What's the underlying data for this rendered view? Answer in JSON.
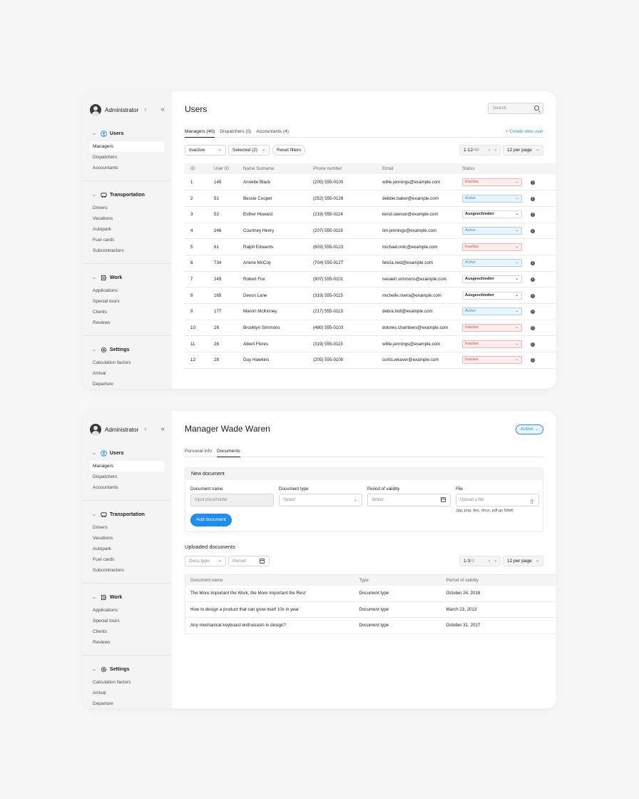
{
  "sidebar": {
    "admin_name": "Administrator",
    "sections": [
      {
        "title": "Users",
        "items": [
          "Managers",
          "Dispatchers",
          "Accountants"
        ]
      },
      {
        "title": "Transportation",
        "items": [
          "Drivers",
          "Vacations",
          "Autopark",
          "Fuel cards",
          "Subcontractors"
        ]
      },
      {
        "title": "Work",
        "items": [
          "Applications",
          "Special tours",
          "Clients",
          "Reviews"
        ]
      },
      {
        "title": "Settings",
        "items": [
          "Calculation factors",
          "Arrival",
          "Departure"
        ]
      }
    ]
  },
  "users_page": {
    "title": "Users",
    "search_placeholder": "Search",
    "tabs": [
      "Managers (40)",
      "Dispatchers (0)",
      "Accountants (4)"
    ],
    "create_link": "+ Create new user",
    "filter_status": "Inactive",
    "filter_selected": "Selected (2)",
    "reset_filters": "Reset filters",
    "pagination": {
      "range": "1-12",
      "total": "/40"
    },
    "per_page": "12 per page",
    "columns": [
      "ID",
      "User ID",
      "Name Surname",
      "Phone number",
      "Email",
      "Status"
    ],
    "rows": [
      {
        "id": "1",
        "uid": "145",
        "name": "Annette Black",
        "phone": "(205) 555-0100",
        "email": "willie.jennings@example.com",
        "status": "Inactive",
        "kind": "inactive",
        "info": true
      },
      {
        "id": "2",
        "uid": "51",
        "name": "Bessie Cooper",
        "phone": "(252) 555-0126",
        "email": "debbie.baker@example.com",
        "status": "Active",
        "kind": "active",
        "info": true
      },
      {
        "id": "3",
        "uid": "52",
        "name": "Esther Howard",
        "phone": "(219) 555-0114",
        "email": "kenzi.lawson@example.com",
        "status": "Ausgeschieden",
        "kind": "aus",
        "info": true
      },
      {
        "id": "4",
        "uid": "246",
        "name": "Courtney Henry",
        "phone": "(207) 555-0119",
        "email": "tim.jennings@example.com",
        "status": "Active",
        "kind": "active",
        "info": true
      },
      {
        "id": "5",
        "uid": "61",
        "name": "Ralph Edwards",
        "phone": "(603) 555-0123",
        "email": "michael.mitc@example.com",
        "status": "Inactive",
        "kind": "inactive",
        "info": false
      },
      {
        "id": "6",
        "uid": "734",
        "name": "Arlene McCoy",
        "phone": "(704) 555-0127",
        "email": "felicia.reid@example.com",
        "status": "Active",
        "kind": "active",
        "info": true
      },
      {
        "id": "7",
        "uid": "245",
        "name": "Robert Fox",
        "phone": "(907) 555-0101",
        "email": "nevaeh.simmons@example.com",
        "status": "Ausgeschieden",
        "kind": "aus",
        "info": true
      },
      {
        "id": "8",
        "uid": "165",
        "name": "Devon Lane",
        "phone": "(319) 555-0115",
        "email": "michelle.rivera@example.com",
        "status": "Ausgeschieden",
        "kind": "aus",
        "info": true
      },
      {
        "id": "9",
        "uid": "177",
        "name": "Marvin McKinney",
        "phone": "(217) 555-0113",
        "email": "debra.holt@example.com",
        "status": "Active",
        "kind": "active",
        "info": true
      },
      {
        "id": "10",
        "uid": "26",
        "name": "Brooklyn Simmons",
        "phone": "(480) 555-0103",
        "email": "dolores.chambers@example.com",
        "status": "Inactive",
        "kind": "inactive",
        "info": true
      },
      {
        "id": "11",
        "uid": "28",
        "name": "Albert Flores",
        "phone": "(319) 555-0115",
        "email": "willie.jennings@example.com",
        "status": "Inactive",
        "kind": "inactive",
        "info": true
      },
      {
        "id": "12",
        "uid": "28",
        "name": "Guy Hawkins",
        "phone": "(205) 555-0100",
        "email": "curtis.weaver@example.com",
        "status": "Inactive",
        "kind": "inactive",
        "info": true
      }
    ]
  },
  "manager_page": {
    "title": "Manager Wade Waren",
    "status_badge": "Active",
    "tabs": [
      "Personal info",
      "Documents"
    ],
    "new_doc": {
      "header": "New document",
      "name_label": "Document name",
      "name_placeholder": "Input placeholder",
      "type_label": "Document type",
      "type_placeholder": "Select",
      "period_label": "Period of validity",
      "period_placeholder": "Select",
      "file_label": "File",
      "file_placeholder": "Upload a file",
      "file_hint": "Jpg, png, doc, docx, pdf до 50мб",
      "add_button": "Add document"
    },
    "uploaded_title": "Uploaded documents",
    "docs_type_filter": "Docs type",
    "period_filter": "Period",
    "pagination": {
      "range": "1-3",
      "total": "/3"
    },
    "per_page": "12 per page",
    "columns": [
      "Document name",
      "Type",
      "Period of validity"
    ],
    "rows": [
      {
        "name": "The More Important the Work, the More Important the Rest",
        "type": "Document type",
        "date": "October 24, 2018"
      },
      {
        "name": "How to design a product that can grow itself 10x in year",
        "type": "Document type",
        "date": "March 23, 2013"
      },
      {
        "name": "Any mechanical keyboard enthusiasts in design?",
        "type": "Document type",
        "date": "October 31, 2017"
      }
    ]
  },
  "colors": {
    "accent": "#2f8cf0",
    "inactive": "#e0463e",
    "sidebar_bg": "#f4f4f5"
  }
}
